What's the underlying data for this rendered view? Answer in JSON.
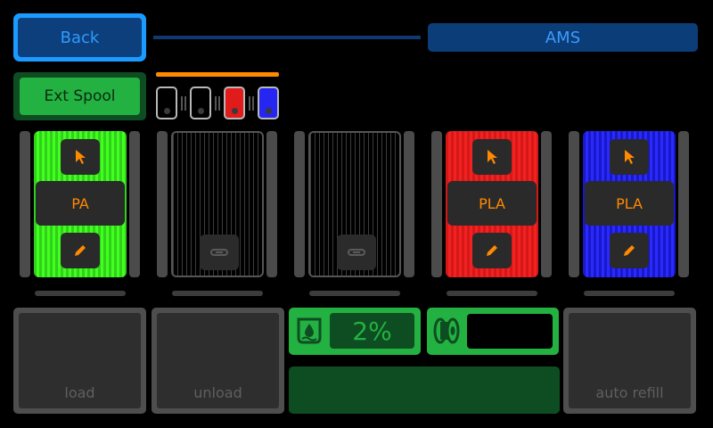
{
  "header": {
    "back_label": "Back",
    "ams_label": "AMS"
  },
  "ext_spool": {
    "label": "Ext Spool"
  },
  "mini_slots": [
    {
      "color": "empty"
    },
    {
      "color": "empty"
    },
    {
      "color": "#e11b1b"
    },
    {
      "color": "#2626f2"
    }
  ],
  "slots": [
    {
      "state": "filled",
      "color": "#43ff1f",
      "material": "PA",
      "icon_top": "cursor-icon",
      "icon_bottom": "pencil-icon"
    },
    {
      "state": "empty",
      "icon": "link-icon"
    },
    {
      "state": "empty",
      "icon": "link-icon"
    },
    {
      "state": "filled",
      "color": "#f22222",
      "material": "PLA",
      "icon_top": "cursor-icon",
      "icon_bottom": "pencil-icon"
    },
    {
      "state": "filled",
      "color": "#2a2aff",
      "material": "PLA",
      "icon_top": "cursor-icon",
      "icon_bottom": "pencil-icon"
    }
  ],
  "actions": {
    "load_label": "load",
    "unload_label": "unload",
    "auto_refill_label": "auto refill"
  },
  "humidity": {
    "value": "2%",
    "icon": "humidity-icon"
  },
  "spool_status": {
    "icon": "spool-icon",
    "value": ""
  },
  "colors": {
    "accent_blue": "#1b9bff",
    "accent_green": "#23b141",
    "accent_orange": "#ff8a00"
  }
}
